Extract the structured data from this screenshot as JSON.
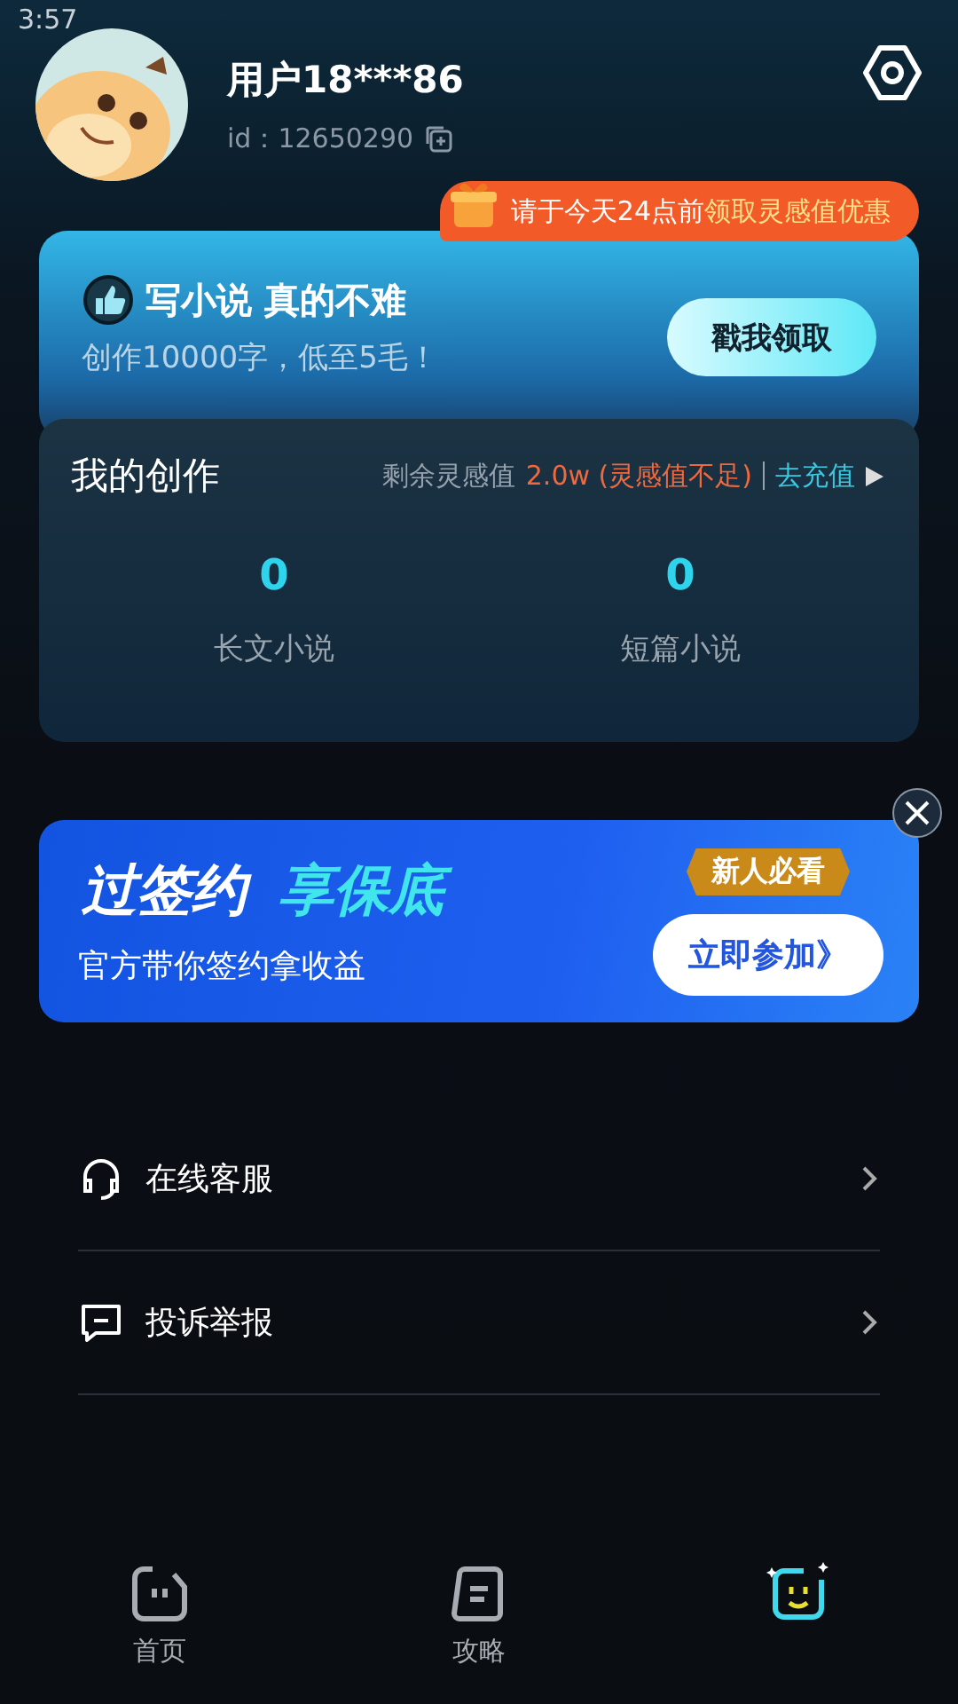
{
  "status_bar": {
    "time": "3:57"
  },
  "profile": {
    "name": "用户18***86",
    "id_label": "id：",
    "id": "12650290"
  },
  "promo_badge": {
    "text": "请于今天24点前",
    "highlight": "领取灵感值优惠"
  },
  "promo_card": {
    "title": "写小说 真的不难",
    "subtitle": "创作10000字，低至5毛！",
    "button": "戳我领取"
  },
  "creation": {
    "title": "我的创作",
    "balance_label": "剩余灵感值",
    "balance": "2.0w (灵感值不足)",
    "recharge": "去充值",
    "stats": [
      {
        "value": "0",
        "label": "长文小说"
      },
      {
        "value": "0",
        "label": "短篇小说"
      }
    ]
  },
  "banner": {
    "title_a": "过签约",
    "title_b": "享保底",
    "subtitle": "官方带你签约拿收益",
    "tag": "新人必看",
    "button": "立即参加》"
  },
  "menu": [
    {
      "kind": "headset",
      "label": "在线客服"
    },
    {
      "kind": "report",
      "label": "投诉举报"
    }
  ],
  "tabs": [
    {
      "kind": "home",
      "label": "首页",
      "selected": false
    },
    {
      "kind": "guide",
      "label": "攻略",
      "selected": false
    },
    {
      "kind": "me",
      "selected": true
    }
  ]
}
